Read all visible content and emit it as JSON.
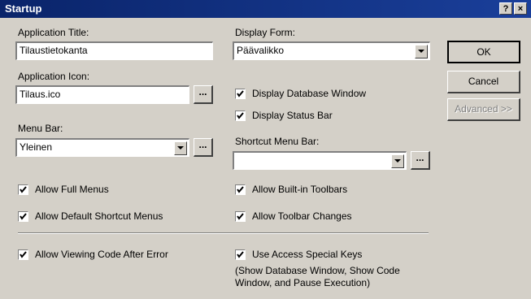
{
  "window": {
    "title": "Startup",
    "help_label": "?",
    "close_label": "×"
  },
  "left": {
    "app_title_label": "Application Title:",
    "app_title_value": "Tilaustietokanta",
    "app_icon_label": "Application Icon:",
    "app_icon_value": "Tilaus.ico",
    "menu_bar_label": "Menu Bar:",
    "menu_bar_value": "Yleinen",
    "browse_label": "...",
    "allow_full_menus": "Allow Full Menus",
    "allow_default_shortcut_menus": "Allow Default Shortcut Menus",
    "allow_viewing_code": "Allow Viewing Code After Error"
  },
  "right": {
    "display_form_label": "Display Form:",
    "display_form_value": "Päävalikko",
    "display_database_window": "Display Database Window",
    "display_status_bar": "Display Status Bar",
    "shortcut_menu_bar_label": "Shortcut Menu Bar:",
    "shortcut_menu_bar_value": "",
    "allow_builtin_toolbars": "Allow Built-in Toolbars",
    "allow_toolbar_changes": "Allow Toolbar Changes",
    "use_access_special_keys": "Use Access Special Keys",
    "special_keys_note": "(Show Database Window, Show Code Window, and Pause Execution)"
  },
  "buttons": {
    "ok": "OK",
    "cancel": "Cancel",
    "advanced": "Advanced >>"
  },
  "checkboxes_checked": true,
  "colors": {
    "titlebar": "#0a246a",
    "face": "#d4d0c8"
  }
}
